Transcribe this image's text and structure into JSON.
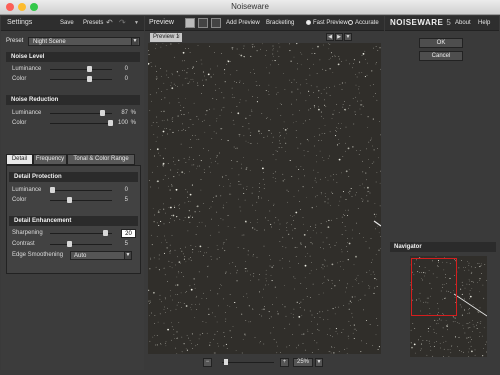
{
  "window": {
    "title": "Noiseware"
  },
  "left": {
    "title": "Settings",
    "save": "Save",
    "presets": "Presets",
    "preset_label": "Preset",
    "preset_value": "Night Scene",
    "noise_level": {
      "title": "Noise Level",
      "luminance": {
        "label": "Luminance",
        "value": "0"
      },
      "color": {
        "label": "Color",
        "value": "0"
      }
    },
    "noise_reduction": {
      "title": "Noise Reduction",
      "luminance": {
        "label": "Luminance",
        "value": "87",
        "unit": "%"
      },
      "color": {
        "label": "Color",
        "value": "100",
        "unit": "%"
      }
    },
    "tabs": [
      "Detail",
      "Frequency",
      "Tonal & Color Range"
    ],
    "detail_protection": {
      "title": "Detail Protection",
      "luminance": {
        "label": "Luminance",
        "value": "0"
      },
      "color": {
        "label": "Color",
        "value": "5"
      }
    },
    "detail_enhancement": {
      "title": "Detail Enhancement",
      "sharpening": {
        "label": "Sharpening",
        "value": "20"
      },
      "contrast": {
        "label": "Contrast",
        "value": "5"
      },
      "edge": {
        "label": "Edge Smoothening",
        "value": "Auto"
      }
    }
  },
  "center": {
    "title": "Preview",
    "add_preview": "Add Preview",
    "bracketing": "Bracketing",
    "fast_preview": "Fast Preview",
    "accurate": "Accurate",
    "tab_label": "Preview 1",
    "zoom": "25%"
  },
  "right": {
    "logo": "NOISEWARE",
    "version": "5",
    "about": "About",
    "help": "Help",
    "ok": "OK",
    "cancel": "Cancel",
    "navigator": "Navigator"
  },
  "colors": {
    "close": "#fc5f57",
    "minimize": "#fdbc2e",
    "zoom": "#34c84a",
    "navigator_frame": "#d41e1e"
  },
  "levels": {
    "noise_level_luminance": 0.64,
    "noise_level_color": 0.64,
    "noise_reduction_luminance": 0.87,
    "noise_reduction_color": 1.0,
    "detail_protection_luminance": 0.0,
    "detail_protection_color": 0.3,
    "detail_enhancement_sharpening": 0.92,
    "detail_enhancement_contrast": 0.3,
    "zoom_slider": 0.05
  }
}
